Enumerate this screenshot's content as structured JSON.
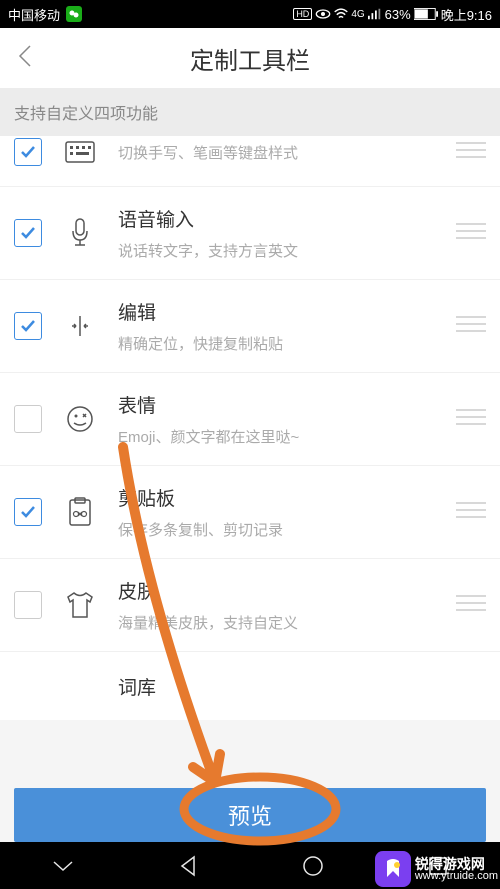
{
  "status": {
    "carrier": "中国移动",
    "hd": "HD",
    "net": "4G",
    "battery": "63%",
    "time": "晚上9:16"
  },
  "header": {
    "title": "定制工具栏"
  },
  "banner": "支持自定义四项功能",
  "items": [
    {
      "title": "",
      "desc": "切换手写、笔画等键盘样式",
      "checked": true
    },
    {
      "title": "语音输入",
      "desc": "说话转文字，支持方言英文",
      "checked": true
    },
    {
      "title": "编辑",
      "desc": "精确定位，快捷复制粘贴",
      "checked": true
    },
    {
      "title": "表情",
      "desc": "Emoji、颜文字都在这里哒~",
      "checked": false
    },
    {
      "title": "剪贴板",
      "desc": "保存多条复制、剪切记录",
      "checked": true
    },
    {
      "title": "皮肤",
      "desc": "海量精美皮肤，支持自定义",
      "checked": false
    },
    {
      "title": "词库",
      "desc": "",
      "checked": false
    }
  ],
  "preview": "预览",
  "watermark": {
    "line1": "锐得游戏网",
    "line2": "www.ytruide.com"
  }
}
